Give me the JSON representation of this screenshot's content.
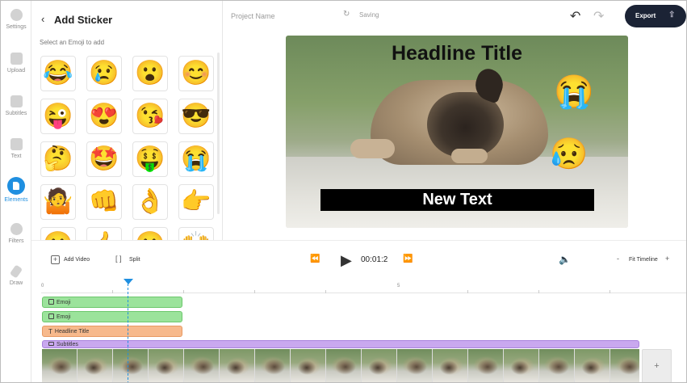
{
  "sidebar": {
    "items": [
      {
        "label": "Settings",
        "icon": "settings-icon"
      },
      {
        "label": "Upload",
        "icon": "upload-icon"
      },
      {
        "label": "Subtitles",
        "icon": "subtitles-icon"
      },
      {
        "label": "Text",
        "icon": "text-icon"
      },
      {
        "label": "Elements",
        "icon": "elements-icon",
        "active": true
      },
      {
        "label": "Filters",
        "icon": "filters-icon"
      },
      {
        "label": "Draw",
        "icon": "draw-icon"
      }
    ],
    "active_color": "#1f8fe0"
  },
  "sticker_panel": {
    "back_glyph": "‹",
    "title": "Add Sticker",
    "subtitle": "Select an Emoji to add",
    "emojis": [
      "😂",
      "😢",
      "😮",
      "😊",
      "😜",
      "😍",
      "😘",
      "😎",
      "🤔",
      "🤩",
      "🤑",
      "😭",
      "🤷",
      "👊",
      "👌",
      "👉",
      "😀",
      "👍",
      "🙂",
      "🙌"
    ]
  },
  "header": {
    "project_name": "Project Name",
    "saving_glyph": "↻",
    "saving_label": "Saving",
    "undo_glyph": "↶",
    "redo_glyph": "↷",
    "export_label": "Export",
    "export_glyph": "⇪",
    "export_bg": "#1b2335"
  },
  "canvas": {
    "headline": "Headline Title",
    "emoji_top": "😭",
    "emoji_bottom": "😥",
    "caption": "New Text"
  },
  "controls": {
    "add_video_glyph": "+",
    "add_video_label": "Add Video",
    "split_glyph": "[ ]",
    "split_label": "Split",
    "rewind_glyph": "⏪",
    "play_glyph": "▶",
    "time": "00:01:2",
    "forward_glyph": "⏩",
    "volume_glyph": "🔈",
    "zoom_minus": "-",
    "fit_label": "Fit Timeline",
    "zoom_plus": "+"
  },
  "timeline": {
    "ruler_labels": [
      "0",
      "5"
    ],
    "tracks": [
      {
        "label": "Emoji",
        "type": "emoji"
      },
      {
        "label": "Emoji",
        "type": "emoji"
      },
      {
        "label": "Headline Title",
        "type": "text"
      },
      {
        "label": "Subtitles",
        "type": "subtitles"
      }
    ],
    "add_track_glyph": "+"
  }
}
